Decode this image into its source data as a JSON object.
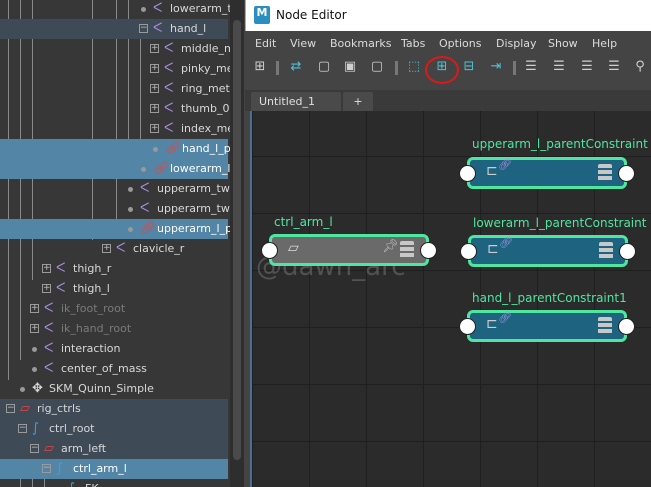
{
  "outliner": {
    "rows": [
      {
        "label": "lowerarm_t",
        "icon": "joint-icon",
        "exp": "",
        "indent": 170,
        "state": ""
      },
      {
        "label": "hand_l",
        "icon": "joint-icon",
        "exp": "−",
        "indent": 170,
        "state": "parentsel"
      },
      {
        "label": "middle_m",
        "icon": "joint-icon",
        "exp": "+",
        "indent": 181,
        "state": ""
      },
      {
        "label": "pinky_met",
        "icon": "joint-icon",
        "exp": "+",
        "indent": 181,
        "state": ""
      },
      {
        "label": "ring_met",
        "icon": "joint-icon",
        "exp": "+",
        "indent": 181,
        "state": ""
      },
      {
        "label": "thumb_0",
        "icon": "joint-icon",
        "exp": "+",
        "indent": 181,
        "state": ""
      },
      {
        "label": "index_me",
        "icon": "joint-icon",
        "exp": "+",
        "indent": 181,
        "state": ""
      },
      {
        "label": "hand_l_p",
        "icon": "link-icon",
        "exp": "",
        "indent": 182,
        "state": "sel"
      },
      {
        "label": "lowerarm_l_",
        "icon": "link-icon",
        "exp": "",
        "indent": 170,
        "state": "sel"
      },
      {
        "label": "upperarm_twi",
        "icon": "joint-icon",
        "exp": "",
        "indent": 157,
        "state": ""
      },
      {
        "label": "upperarm_twi",
        "icon": "joint-icon",
        "exp": "",
        "indent": 157,
        "state": ""
      },
      {
        "label": "upperarm_l_p",
        "icon": "link-icon",
        "exp": "",
        "indent": 157,
        "state": "sel"
      },
      {
        "label": "clavicle_r",
        "icon": "joint-icon",
        "exp": "+",
        "indent": 133,
        "state": ""
      },
      {
        "label": "thigh_r",
        "icon": "joint-icon",
        "exp": "+",
        "indent": 73,
        "state": ""
      },
      {
        "label": "thigh_l",
        "icon": "joint-icon",
        "exp": "+",
        "indent": 73,
        "state": ""
      },
      {
        "label": "ik_foot_root",
        "icon": "joint-icon",
        "exp": "+",
        "indent": 61,
        "state": "dim"
      },
      {
        "label": "ik_hand_root",
        "icon": "joint-icon",
        "exp": "+",
        "indent": 61,
        "state": "dim"
      },
      {
        "label": "interaction",
        "icon": "joint-icon",
        "exp": "",
        "indent": 61,
        "state": ""
      },
      {
        "label": "center_of_mass",
        "icon": "joint-icon",
        "exp": "",
        "indent": 61,
        "state": ""
      },
      {
        "label": "SKM_Quinn_Simple",
        "icon": "mesh-icon",
        "exp": "",
        "indent": 49,
        "state": ""
      },
      {
        "label": "rig_ctrls",
        "icon": "transform-icon",
        "exp": "−",
        "indent": 37,
        "state": "parentsel"
      },
      {
        "label": "ctrl_root",
        "icon": "curve-icon",
        "exp": "−",
        "indent": 49,
        "state": "parentsel"
      },
      {
        "label": "arm_left",
        "icon": "transform-icon",
        "exp": "−",
        "indent": 61,
        "state": "parentsel"
      },
      {
        "label": "ctrl_arm_l",
        "icon": "curve-icon",
        "exp": "−",
        "indent": 73,
        "state": "sel"
      },
      {
        "label": "FK",
        "icon": "curve-icon",
        "exp": "",
        "indent": 85,
        "state": ""
      }
    ]
  },
  "window": {
    "title": "Node Editor",
    "logo": "M"
  },
  "menu": [
    "Edit",
    "View",
    "Bookmarks",
    "Tabs",
    "Options",
    "Display",
    "Show",
    "Help"
  ],
  "tabs": {
    "active": "Untitled_1",
    "close": "✕",
    "add": "+"
  },
  "nodes": [
    {
      "name": "ctrl_arm_l",
      "type": "transform"
    },
    {
      "name": "upperarm_l_parentConstraint",
      "type": "constraint"
    },
    {
      "name": "lowerarm_l_parentConstraint",
      "type": "constraint"
    },
    {
      "name": "hand_l_parentConstraint1",
      "type": "constraint"
    }
  ],
  "watermark": "@dawn_arc",
  "colors": {
    "selection": "#5285a6",
    "node_outline": "#4fe6a0",
    "constraint_node": "#1e6380",
    "highlight_circle": "#e01818"
  }
}
